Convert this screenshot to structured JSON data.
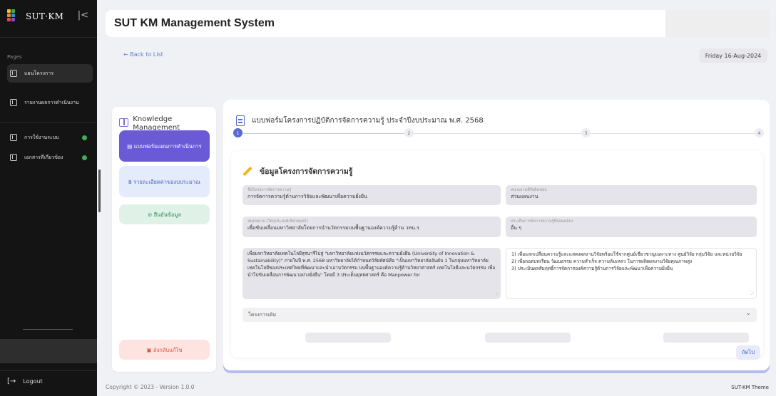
{
  "sidebar": {
    "brand": "SUT·KM",
    "collapse_icon": "collapse-left-icon",
    "pages_label": "Pages",
    "items": [
      {
        "label": "แผนโครงการ",
        "icon": "grid-icon",
        "active": true
      },
      {
        "label": "รายงานผลการดำเนินงาน",
        "icon": "report-icon",
        "active": false
      },
      {
        "label": "การใช้งานระบบ",
        "icon": "grid-icon",
        "active": false
      },
      {
        "label": "เอกสารที่เกี่ยวข้อง",
        "icon": "download-icon",
        "active": false
      }
    ],
    "logout_label": "Logout"
  },
  "header": {
    "title": "SUT KM Management System"
  },
  "top": {
    "back_label": "← Back to List",
    "date": "Friday 16-Aug-2024"
  },
  "steps_card": {
    "title": "Knowledge Management",
    "steps": [
      {
        "label": "แบบฟอร์มแผนการดำเนินการ"
      },
      {
        "label": "รายละเอียดค่าของบประมาณ"
      },
      {
        "label": "ยืนยันข้อมูล"
      }
    ],
    "return_label": "ส่งกลับแก้ไข"
  },
  "form": {
    "title": "แบบฟอร์มโครงการปฏิบัติการจัดการความรู้ ประจำปีงบประมาณ พ.ศ. 2568",
    "stepper": [
      "1",
      "2",
      "3",
      "4"
    ],
    "section_title": "ข้อมูลโครงการจัดการความรู้",
    "fields": {
      "project_name": {
        "label": "ชื่อโครงการจัดการความรู้",
        "value": "การจัดการความรู้ด้านการวิจัยและพัฒนาเพื่อความยั่งยืน"
      },
      "unit": {
        "label": "หน่วยงานที่รับผิดชอบ",
        "value": "ส่วนแผนงาน"
      },
      "objective": {
        "label": "หมุดหมาย (วัตถุประสงค์เชิงกลยุทธ์)",
        "value": "เพื่อขับเคลื่อนมหาวิทยาลัยโดยการนำนวัตกรรมบนพื้นฐานองค์ความรู้ด้าน  วทน.ร"
      },
      "issue": {
        "label": "ประเด็นการจัดการความรู้ที่สอดคล้อง",
        "value": "อื่น ๆ"
      },
      "rationale": "เพื่อมหาวิทยาลัยเทคโนโลยีสุรนารีไปสู่ \"มหาวิทยาลัยแห่งนวัตกรรมและความยั่งยืน (University of Innovation & Sustainability)\" ภายในปี พ.ศ. 2568 มหาวิทยาลัยได้กำหนดวิสัยทัศน์คือ \"เป็นมหาวิทยาลัยอันดับ 1 ในกลุ่มมหาวิทยาลัยเทคโนโลยีของประเทศไทยที่พัฒนาและนำเอานวัตกรรม บนพื้นฐานองค์ความรู้ด้านวิทยาศาสตร์ เทคโนโลยีและนวัตกรรม เพื่อนำไปขับเคลื่อนการพัฒนาอย่างยั่งยืน\" โดยมี 3 ประเด็นยุทธศาสตร์ คือ Manpower for",
      "goals": "1)   เพื่อแลกเปลี่ยนความรู้และแสดงผลงานวิจัยพร้อมใช้จากศูนย์เชี่ยวชาญเฉพาะทาง ศูนย์วิจัย กลุ่มวิจัย และหน่วยวิจัย\n2)   เพื่อถอดบทเรียน วัฒนธรรม ความสำเร็จ ความล้มเหลว ในการผลิตผลงานวิจัยคุณภาพสูง\n3)   ประเมินผลสัมฤทธิ์การจัดการองค์ความรู้ด้านการวิจัยและพัฒนาเพื่อความยั่งยืน"
    },
    "accordion_label": "โครงการเดิม",
    "next_label": "ถัดไป"
  },
  "footer": {
    "copyright": "Copyright © 2023 - Version 1.0.0",
    "theme": "SUT-KM Theme"
  }
}
